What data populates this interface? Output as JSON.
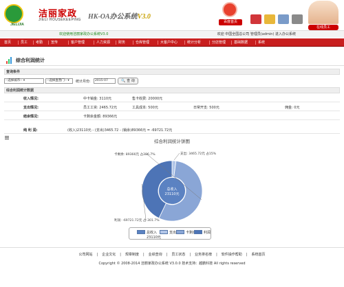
{
  "header": {
    "logo_sub": "JIELIJIA",
    "brand_cn": "洁丽家政",
    "brand_en": "JIELI HOUSEKEEPING",
    "system_name": "HK-OA办公系统",
    "version": "V3.0",
    "home_label": "百度首页",
    "online_label": "在线员工"
  },
  "welcome": {
    "left": "欢迎使用洁丽家政办公系统V3.0",
    "right": "欢迎 中国全国总公司 管理员(admin) 进入办公系统"
  },
  "nav": {
    "items": [
      "首页",
      "员工",
      "考勤",
      "宣传",
      "客户管理",
      "人力资源",
      "财务",
      "仓库管理",
      "大客户中心",
      "统计分析",
      "分店管理",
      "基础数据",
      "系统"
    ]
  },
  "page": {
    "title": "综合利润统计",
    "cond_label": "查询条件",
    "city_select": "--选择城市--",
    "store_select": "--选择直营门--",
    "month_label": "统计月份:",
    "month_value": "2015-07",
    "query_button": "查 询",
    "section_label": "综合利润统计数据"
  },
  "stats": {
    "income": {
      "head": "收入情况:",
      "a": "中卡销金: 3110元",
      "b": "售卡收费: 20000元"
    },
    "expense": {
      "head": "支出情况:",
      "a": "员工工资: 2465.72元",
      "b": "工具成本: 500元",
      "c": "日常开支: 500元",
      "d": "佣金: 0元"
    },
    "card": {
      "head": "结余情况:",
      "a": "卡剩余金额: 89366元"
    },
    "profit": {
      "head": "纯 利 润:",
      "formula": "(收入)23110元 - (支出)3465.72 - (销余)89366元 = -69721.72元"
    }
  },
  "chart_data": {
    "type": "pie",
    "title": "综合利润统计饼图",
    "categories": [
      "总收入",
      "支出",
      "卡剩余",
      "利润"
    ],
    "values": [
      23110,
      3465.72,
      89366,
      -69721.72
    ],
    "percent_labels": [
      "",
      "支出: 3465.72元 占15%",
      "卡剩余: 89366元 占386.7%",
      "利润: -69721.72元 占-301.7%"
    ],
    "center_label": "总收入",
    "center_value": "23110元",
    "legend_placement": "bottom",
    "colors": {
      "inner": "#5b82c2",
      "expense": "#b2c6e8",
      "card": "#8aa6d6",
      "profit": "#4d74b6"
    }
  },
  "legend": {
    "items": [
      "总收入",
      "支出",
      "卡剩余",
      "利润"
    ],
    "last_line": "23110元"
  },
  "footer": {
    "links": [
      "公司网站",
      "企业文化",
      "规章制度",
      "业绩查询",
      "员工状态",
      "业务排名榜",
      "软件操作帮助",
      "系统首页"
    ],
    "copyright": "Copyright © 2008-2014 洁丽家政办公系统 V3.0.0 技术支持：越鹏科技 All rights reserved"
  },
  "colors": {
    "brand_red": "#c81e1e",
    "brand_green": "#2a9a3a",
    "text_green": "#1a8a1a"
  }
}
